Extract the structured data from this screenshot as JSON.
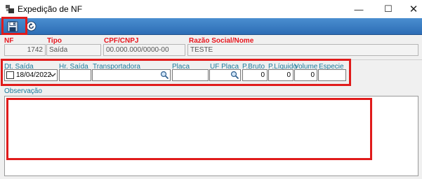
{
  "window": {
    "title": "Expedição de NF",
    "min_glyph": "—",
    "max_glyph": "☐",
    "close_glyph": "✕"
  },
  "toolbar": {
    "save_icon": "floppy-disk-icon",
    "refresh_icon": "refresh-icon"
  },
  "header": {
    "nf_label": "NF",
    "nf_value": "1742",
    "tipo_label": "Tipo",
    "tipo_value": "Saída",
    "cpf_label": "CPF/CNPJ",
    "cpf_value": "00.000.000/0000-00",
    "razao_label": "Razão Social/Nome",
    "razao_value": "TESTE"
  },
  "shipping": {
    "dt_saida_label": "Dt. Saída",
    "dt_saida_value": "18/04/2022",
    "hr_saida_label": "Hr. Saída",
    "hr_saida_value": "",
    "transportadora_label": "Transportadora",
    "transportadora_value": "",
    "placa_label": "Placa",
    "placa_value": "",
    "uf_placa_label": "UF Placa",
    "uf_placa_value": "",
    "pbruto_label": "P.Bruto",
    "pbruto_value": "0",
    "pliquido_label": "P.Líquido",
    "pliquido_value": "0",
    "volume_label": "Volume",
    "volume_value": "0",
    "especie_label": "Especie",
    "especie_value": ""
  },
  "observacao": {
    "label": "Observação",
    "value": ""
  },
  "colors": {
    "toolbar": "#2d6db5",
    "highlight": "#e01b1b",
    "required_label": "#e8141c",
    "label": "#1b7a9c"
  }
}
